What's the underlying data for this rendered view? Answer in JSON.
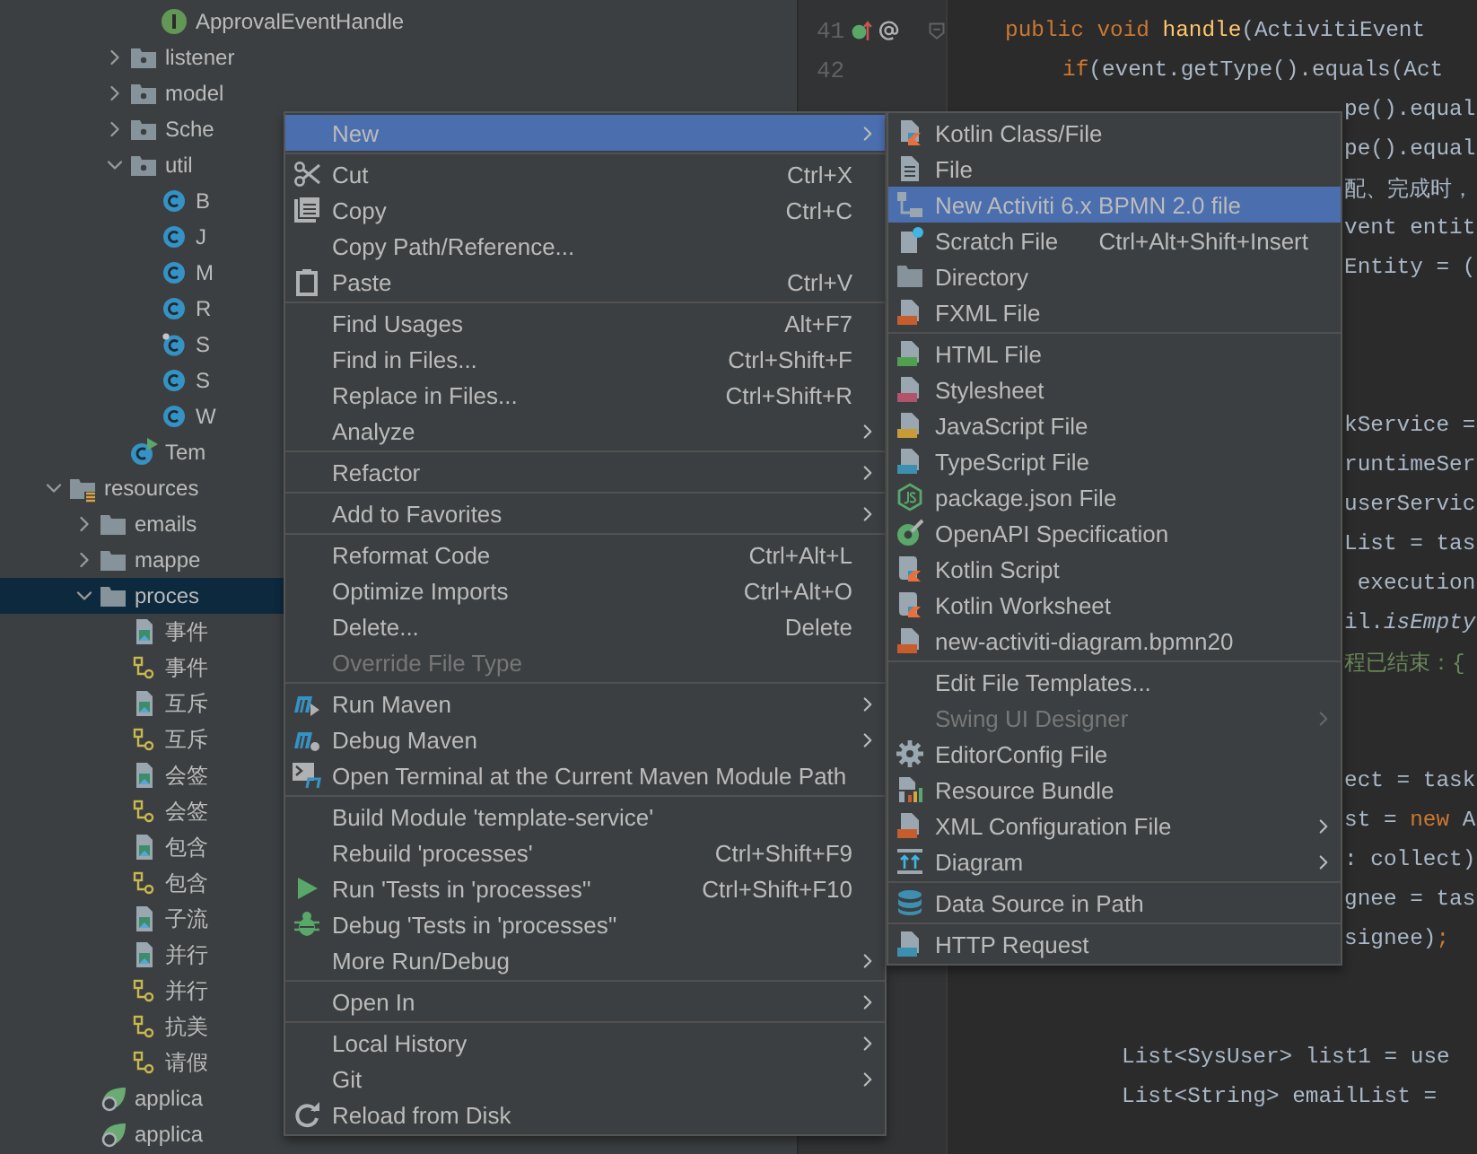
{
  "tree": [
    {
      "kind": "continuation",
      "children": [
        {
          "kind": "continuation",
          "children": [
            {
              "kind": "continuation",
              "children": [
                {
                  "kind": "interface",
                  "label": "ApprovalEventHandle",
                  "selected": false
                }
              ]
            },
            {
              "kind": "package",
              "label": "listener",
              "expanded": false,
              "selected": false
            },
            {
              "kind": "package",
              "label": "model",
              "expanded": false,
              "selected": false
            },
            {
              "kind": "package",
              "label": "Sche",
              "expanded": false,
              "selected": false
            },
            {
              "kind": "package",
              "label": "util",
              "expanded": true,
              "selected": false,
              "children": [
                {
                  "kind": "class",
                  "label": "B",
                  "selected": false
                },
                {
                  "kind": "class",
                  "label": "J",
                  "selected": false
                },
                {
                  "kind": "class",
                  "label": "M",
                  "selected": false
                },
                {
                  "kind": "class",
                  "label": "R",
                  "selected": false
                },
                {
                  "kind": "class-pinned",
                  "label": "S",
                  "selected": false
                },
                {
                  "kind": "class",
                  "label": "S",
                  "selected": false
                },
                {
                  "kind": "class",
                  "label": "W",
                  "selected": false
                }
              ]
            },
            {
              "kind": "test-class",
              "label": "Tem",
              "selected": false
            }
          ]
        }
      ]
    },
    {
      "kind": "resources-folder",
      "label": "resources",
      "expanded": true,
      "selected": false,
      "children": [
        {
          "kind": "folder",
          "label": "emails",
          "expanded": false,
          "selected": false
        },
        {
          "kind": "folder",
          "label": "mappe",
          "expanded": false,
          "selected": false
        },
        {
          "kind": "folder",
          "label": "proces",
          "expanded": true,
          "selected": true,
          "children": [
            {
              "kind": "image",
              "label": "事件",
              "selected": false
            },
            {
              "kind": "diagram",
              "label": "事件",
              "selected": false
            },
            {
              "kind": "image",
              "label": "互斥",
              "selected": false
            },
            {
              "kind": "diagram",
              "label": "互斥",
              "selected": false
            },
            {
              "kind": "image",
              "label": "会签",
              "selected": false
            },
            {
              "kind": "diagram",
              "label": "会签",
              "selected": false
            },
            {
              "kind": "image",
              "label": "包含",
              "selected": false
            },
            {
              "kind": "diagram",
              "label": "包含",
              "selected": false
            },
            {
              "kind": "image",
              "label": "子流",
              "selected": false
            },
            {
              "kind": "image",
              "label": "并行",
              "selected": false
            },
            {
              "kind": "diagram",
              "label": "并行",
              "selected": false
            },
            {
              "kind": "diagram",
              "label": "抗美",
              "selected": false
            },
            {
              "kind": "diagram",
              "label": "请假",
              "selected": false
            }
          ]
        },
        {
          "kind": "spring",
          "label": "applica",
          "selected": false
        },
        {
          "kind": "spring",
          "label": "applica",
          "selected": false
        }
      ]
    }
  ],
  "gutter": [
    {
      "number": "41",
      "markers": [
        {
          "kind": "override"
        },
        {
          "kind": "annotation"
        },
        {
          "kind": "fold"
        }
      ]
    },
    {
      "number": "42"
    }
  ],
  "code_lines": [
    {
      "kind": "outer",
      "tokens": [
        {
          "text": "public void ",
          "kind": "keyword"
        },
        {
          "text": "handle",
          "kind": "method"
        },
        {
          "text": "(ActivitiEvent",
          "kind": "plain"
        }
      ]
    },
    {
      "kind": "inner",
      "tokens": [
        {
          "text": "if",
          "kind": "keyword"
        },
        {
          "text": "(event.getType().equals(Act",
          "kind": "plain"
        }
      ]
    },
    {
      "kind": "tail",
      "tokens": [
        {
          "text": "pe().equal",
          "kind": "plain"
        }
      ]
    },
    {
      "kind": "tail",
      "tokens": [
        {
          "text": "pe().equal",
          "kind": "plain"
        }
      ]
    },
    {
      "kind": "tail",
      "tokens": [
        {
          "text": "配、完成时，",
          "kind": "plain"
        }
      ]
    },
    {
      "kind": "tail",
      "tokens": [
        {
          "text": "vent entit",
          "kind": "plain"
        }
      ]
    },
    {
      "kind": "tail",
      "tokens": [
        {
          "text": "Entity = (",
          "kind": "plain"
        }
      ]
    },
    {
      "kind": "blank"
    },
    {
      "kind": "blank"
    },
    {
      "kind": "blank"
    },
    {
      "kind": "tail",
      "tokens": [
        {
          "text": "kService =",
          "kind": "plain"
        }
      ]
    },
    {
      "kind": "tail",
      "tokens": [
        {
          "text": "runtimeSer",
          "kind": "plain"
        }
      ]
    },
    {
      "kind": "tail",
      "tokens": [
        {
          "text": "userServic",
          "kind": "plain"
        }
      ]
    },
    {
      "kind": "tail",
      "tokens": [
        {
          "text": "List = tas",
          "kind": "plain"
        }
      ]
    },
    {
      "kind": "tail",
      "tokens": [
        {
          "text": " execution",
          "kind": "plain"
        }
      ]
    },
    {
      "kind": "tail",
      "tokens": [
        {
          "text": "il.",
          "kind": "plain"
        },
        {
          "text": "isEmpty",
          "kind": "static"
        }
      ]
    },
    {
      "kind": "tail",
      "tokens": [
        {
          "text": "程已结束：{",
          "kind": "string"
        }
      ]
    },
    {
      "kind": "blank"
    },
    {
      "kind": "blank"
    },
    {
      "kind": "tail",
      "tokens": [
        {
          "text": "ect = task",
          "kind": "plain"
        }
      ]
    },
    {
      "kind": "tail",
      "tokens": [
        {
          "text": "st = ",
          "kind": "plain"
        },
        {
          "text": "new",
          "kind": "keyword"
        },
        {
          "text": " A",
          "kind": "plain"
        }
      ]
    },
    {
      "kind": "tail",
      "tokens": [
        {
          "text": ": collect)",
          "kind": "plain"
        }
      ]
    },
    {
      "kind": "tail",
      "tokens": [
        {
          "text": "gnee = tas",
          "kind": "plain"
        }
      ]
    },
    {
      "kind": "tail",
      "tokens": [
        {
          "text": "signee)",
          "kind": "plain"
        },
        {
          "text": ";",
          "kind": "keyword"
        }
      ]
    },
    {
      "kind": "blank"
    },
    {
      "kind": "blank"
    },
    {
      "kind": "deep",
      "tokens": [
        {
          "text": "List<SysUser> list1 = use",
          "kind": "plain"
        }
      ]
    },
    {
      "kind": "deep",
      "tokens": [
        {
          "text": "List<String> emailList =",
          "kind": "plain"
        }
      ]
    }
  ],
  "context_menu": {
    "groups": [
      [
        {
          "label": "New",
          "kind": "plain",
          "submenu": true,
          "disabled": false,
          "selected": true
        }
      ],
      [
        {
          "label": "Cut",
          "kind": "cut",
          "shortcut": "Ctrl+X",
          "submenu": false,
          "disabled": false,
          "selected": false
        },
        {
          "label": "Copy",
          "kind": "copy",
          "shortcut": "Ctrl+C",
          "submenu": false,
          "disabled": false,
          "selected": false
        },
        {
          "label": "Copy Path/Reference...",
          "kind": "plain",
          "submenu": false,
          "disabled": false,
          "selected": false
        },
        {
          "label": "Paste",
          "kind": "paste",
          "shortcut": "Ctrl+V",
          "submenu": false,
          "disabled": false,
          "selected": false
        }
      ],
      [
        {
          "label": "Find Usages",
          "kind": "plain",
          "shortcut": "Alt+F7",
          "submenu": false,
          "disabled": false,
          "selected": false
        },
        {
          "label": "Find in Files...",
          "kind": "plain",
          "shortcut": "Ctrl+Shift+F",
          "submenu": false,
          "disabled": false,
          "selected": false
        },
        {
          "label": "Replace in Files...",
          "kind": "plain",
          "shortcut": "Ctrl+Shift+R",
          "submenu": false,
          "disabled": false,
          "selected": false
        },
        {
          "label": "Analyze",
          "kind": "plain",
          "submenu": true,
          "disabled": false,
          "selected": false
        }
      ],
      [
        {
          "label": "Refactor",
          "kind": "plain",
          "submenu": true,
          "disabled": false,
          "selected": false
        }
      ],
      [
        {
          "label": "Add to Favorites",
          "kind": "plain",
          "submenu": true,
          "disabled": false,
          "selected": false
        }
      ],
      [
        {
          "label": "Reformat Code",
          "kind": "plain",
          "shortcut": "Ctrl+Alt+L",
          "submenu": false,
          "disabled": false,
          "selected": false
        },
        {
          "label": "Optimize Imports",
          "kind": "plain",
          "shortcut": "Ctrl+Alt+O",
          "submenu": false,
          "disabled": false,
          "selected": false
        },
        {
          "label": "Delete...",
          "kind": "plain",
          "shortcut": "Delete",
          "submenu": false,
          "disabled": false,
          "selected": false
        },
        {
          "label": "Override File Type",
          "kind": "plain",
          "submenu": false,
          "disabled": true,
          "selected": false
        }
      ],
      [
        {
          "label": "Run Maven",
          "kind": "maven-run",
          "submenu": true,
          "disabled": false,
          "selected": false
        },
        {
          "label": "Debug Maven",
          "kind": "maven-debug",
          "submenu": true,
          "disabled": false,
          "selected": false
        },
        {
          "label": "Open Terminal at the Current Maven Module Path",
          "kind": "maven-terminal",
          "submenu": false,
          "disabled": false,
          "selected": false
        }
      ],
      [
        {
          "label": "Build Module 'template-service'",
          "kind": "plain",
          "submenu": false,
          "disabled": false,
          "selected": false
        },
        {
          "label": "Rebuild 'processes'",
          "kind": "plain",
          "shortcut": "Ctrl+Shift+F9",
          "submenu": false,
          "disabled": false,
          "selected": false
        },
        {
          "label": "Run 'Tests in 'processes''",
          "kind": "run",
          "shortcut": "Ctrl+Shift+F10",
          "submenu": false,
          "disabled": false,
          "selected": false
        },
        {
          "label": "Debug 'Tests in 'processes''",
          "kind": "debug",
          "submenu": false,
          "disabled": false,
          "selected": false
        },
        {
          "label": "More Run/Debug",
          "kind": "plain",
          "submenu": true,
          "disabled": false,
          "selected": false
        }
      ],
      [
        {
          "label": "Open In",
          "kind": "plain",
          "submenu": true,
          "disabled": false,
          "selected": false
        }
      ],
      [
        {
          "label": "Local History",
          "kind": "plain",
          "submenu": true,
          "disabled": false,
          "selected": false
        },
        {
          "label": "Git",
          "kind": "plain",
          "submenu": true,
          "disabled": false,
          "selected": false
        },
        {
          "label": "Reload from Disk",
          "kind": "reload",
          "submenu": false,
          "disabled": false,
          "selected": false
        }
      ]
    ]
  },
  "new_submenu": {
    "groups": [
      [
        {
          "label": "Kotlin Class/File",
          "kind": "kotlin",
          "submenu": false,
          "disabled": false,
          "selected": false
        },
        {
          "label": "File",
          "kind": "file",
          "submenu": false,
          "disabled": false,
          "selected": false
        },
        {
          "label": "New Activiti 6.x BPMN 2.0 file",
          "kind": "bpmn",
          "submenu": false,
          "disabled": false,
          "selected": true
        },
        {
          "label": "Scratch File",
          "kind": "scratch",
          "shortcut": "Ctrl+Alt+Shift+Insert",
          "submenu": false,
          "disabled": false,
          "selected": false
        },
        {
          "label": "Directory",
          "kind": "folder",
          "submenu": false,
          "disabled": false,
          "selected": false
        },
        {
          "label": "FXML File",
          "kind": "xml",
          "submenu": false,
          "disabled": false,
          "selected": false
        }
      ],
      [
        {
          "label": "HTML File",
          "kind": "html",
          "submenu": false,
          "disabled": false,
          "selected": false
        },
        {
          "label": "Stylesheet",
          "kind": "css",
          "submenu": false,
          "disabled": false,
          "selected": false
        },
        {
          "label": "JavaScript File",
          "kind": "js",
          "submenu": false,
          "disabled": false,
          "selected": false
        },
        {
          "label": "TypeScript File",
          "kind": "ts",
          "submenu": false,
          "disabled": false,
          "selected": false
        },
        {
          "label": "package.json File",
          "kind": "nodejs",
          "submenu": false,
          "disabled": false,
          "selected": false
        },
        {
          "label": "OpenAPI Specification",
          "kind": "openapi",
          "submenu": false,
          "disabled": false,
          "selected": false
        },
        {
          "label": "Kotlin Script",
          "kind": "kotlin-script",
          "submenu": false,
          "disabled": false,
          "selected": false
        },
        {
          "label": "Kotlin Worksheet",
          "kind": "kotlin-script",
          "submenu": false,
          "disabled": false,
          "selected": false
        },
        {
          "label": "new-activiti-diagram.bpmn20",
          "kind": "xml",
          "submenu": false,
          "disabled": false,
          "selected": false
        }
      ],
      [
        {
          "label": "Edit File Templates...",
          "kind": "plain",
          "submenu": false,
          "disabled": false,
          "selected": false
        },
        {
          "label": "Swing UI Designer",
          "kind": "plain",
          "submenu": true,
          "disabled": true,
          "selected": false
        },
        {
          "label": "EditorConfig File",
          "kind": "gear",
          "submenu": false,
          "disabled": false,
          "selected": false
        },
        {
          "label": "Resource Bundle",
          "kind": "bundle",
          "submenu": false,
          "disabled": false,
          "selected": false
        },
        {
          "label": "XML Configuration File",
          "kind": "xml",
          "submenu": true,
          "disabled": false,
          "selected": false
        },
        {
          "label": "Diagram",
          "kind": "diagram",
          "submenu": true,
          "disabled": false,
          "selected": false
        }
      ],
      [
        {
          "label": "Data Source in Path",
          "kind": "database",
          "submenu": false,
          "disabled": false,
          "selected": false
        }
      ],
      [
        {
          "label": "HTTP Request",
          "kind": "api",
          "submenu": false,
          "disabled": false,
          "selected": false
        }
      ]
    ]
  }
}
